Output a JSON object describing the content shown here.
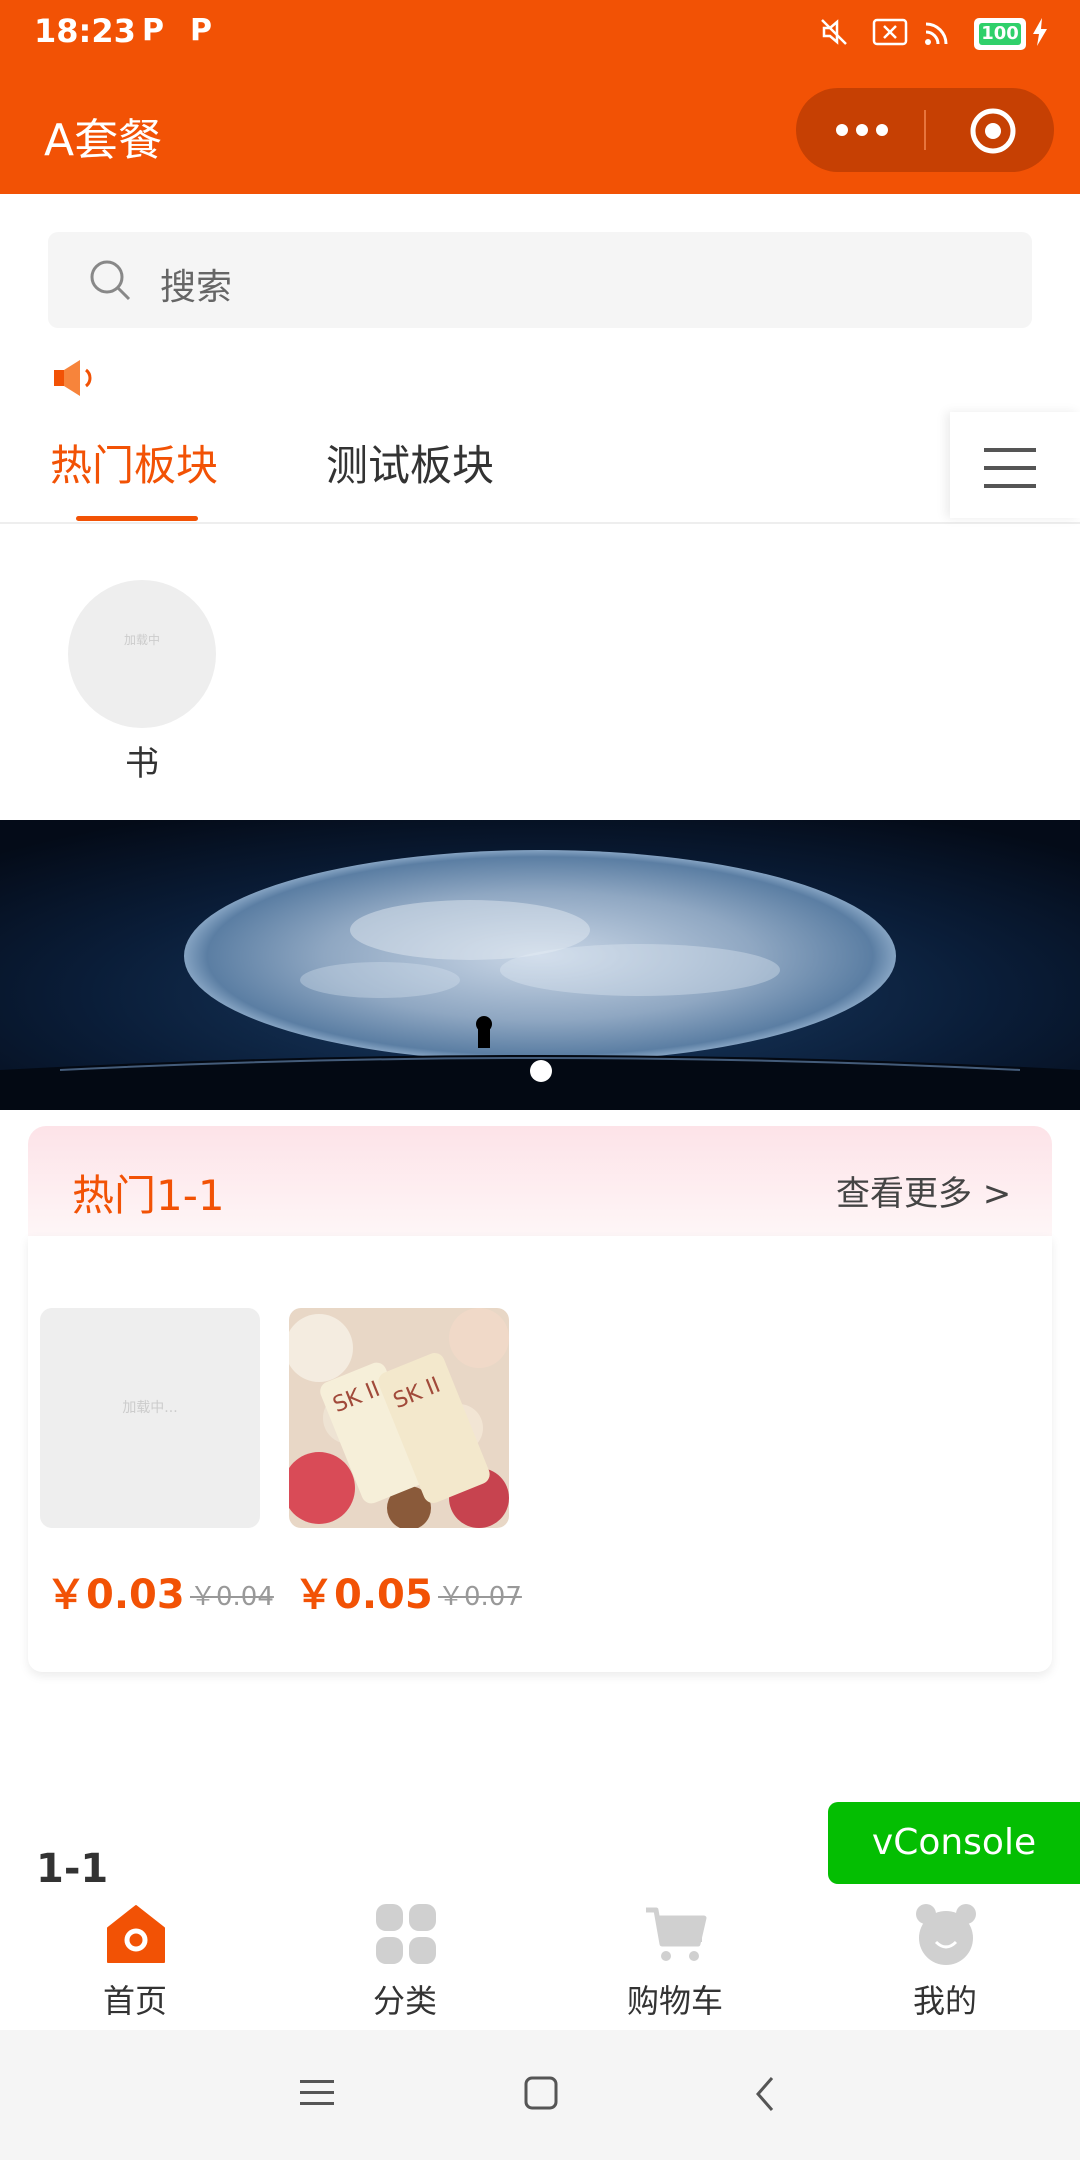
{
  "status_bar": {
    "time": "18:23",
    "badges": [
      "P",
      "P"
    ],
    "icons": [
      "mute-icon",
      "sim-off-icon",
      "wifi-icon",
      "battery-icon",
      "charging-icon"
    ],
    "battery": "100"
  },
  "header": {
    "title": "A套餐",
    "capsule_icons": [
      "more-dots-icon",
      "close-target-icon"
    ]
  },
  "search": {
    "placeholder": "搜索"
  },
  "notice": {
    "icon": "speaker-icon"
  },
  "tabs": [
    {
      "label": "热门板块",
      "active": true
    },
    {
      "label": "测试板块",
      "active": false
    }
  ],
  "categories": [
    {
      "label": "书",
      "image_text": "加载中"
    }
  ],
  "banner": {
    "dots": 1
  },
  "section": {
    "title": "热门1-1",
    "more": "查看更多 >",
    "products": [
      {
        "image_text": "加载中...",
        "price": "￥0.03",
        "old_price": "￥0.04"
      },
      {
        "image_text": "",
        "price": "￥0.05",
        "old_price": "￥0.07"
      }
    ]
  },
  "lower_heading": "1-1",
  "vconsole": "vConsole",
  "tabbar": [
    {
      "label": "首页",
      "icon": "home-icon",
      "active": true
    },
    {
      "label": "分类",
      "icon": "category-icon",
      "active": false
    },
    {
      "label": "购物车",
      "icon": "cart-icon",
      "active": false
    },
    {
      "label": "我的",
      "icon": "profile-bear-icon",
      "active": false
    }
  ],
  "colors": {
    "brand": "#f25205",
    "vconsole": "#04be02",
    "inactive_icon": "#d0d0d0"
  }
}
